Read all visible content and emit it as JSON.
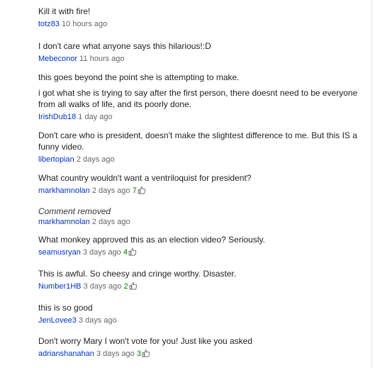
{
  "comments": [
    {
      "paragraphs": [
        "Kill it with fire!"
      ],
      "author": "totz83",
      "time": "10 hours ago"
    },
    {
      "paragraphs": [
        "I don't care what anyone says this hilarious!:D"
      ],
      "author": "Mebeconor",
      "time": "11 hours ago"
    },
    {
      "paragraphs": [
        "this goes beyond the point she is attempting to make.",
        "i got what she is trying to say after the first person, there doesnt need to be everyone from all walks of life, and its poorly done."
      ],
      "author": "IrishDub18",
      "time": "1 day ago"
    },
    {
      "paragraphs": [
        "Don't care who is president, doesn't make the slightest difference to me. But this IS a funny video."
      ],
      "author": "libertopian",
      "time": "2 days ago"
    },
    {
      "paragraphs": [
        "What country wouldn't want a ventriloquist for president?"
      ],
      "author": "markhamnolan",
      "time": "2 days ago",
      "likes": "7"
    },
    {
      "paragraphs": [
        "Comment removed"
      ],
      "removed": true,
      "author": "markhamnolan",
      "time": "2 days ago"
    },
    {
      "paragraphs": [
        "What monkey approved this as an election video? Seriously."
      ],
      "author": "seamusryan",
      "time": "3 days ago",
      "likes": "4"
    },
    {
      "paragraphs": [
        "This is awful. So cheesy and cringe worthy. Disaster."
      ],
      "author": "Number1HB",
      "time": "3 days ago",
      "likes": "2"
    },
    {
      "paragraphs": [
        "this is so good"
      ],
      "author": "JenLovee3",
      "time": "3 days ago"
    },
    {
      "paragraphs": [
        "Don't worry Mary I won't vote for you! Just like you asked"
      ],
      "author": "adrianshanahan",
      "time": "3 days ago",
      "likes": "3"
    }
  ],
  "colors": {
    "author_link": "#0033cc",
    "likes": "#008000",
    "text": "#222222",
    "meta": "#666666"
  },
  "icons": {
    "like": "thumbs-up-icon"
  }
}
